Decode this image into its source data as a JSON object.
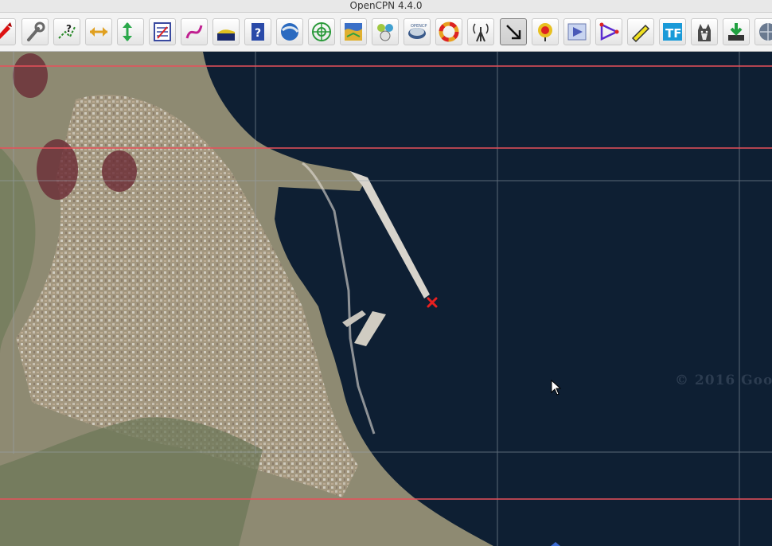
{
  "window": {
    "title": "OpenCPN 4.4.0"
  },
  "toolbar": {
    "buttons": [
      {
        "name": "routes-icon"
      },
      {
        "name": "settings-wrench-icon"
      },
      {
        "name": "route-help-icon"
      },
      {
        "name": "scale-horizontal-icon"
      },
      {
        "name": "scale-vertical-icon"
      },
      {
        "name": "route-manager-icon"
      },
      {
        "name": "track-icon"
      },
      {
        "name": "tide-icon"
      },
      {
        "name": "help-book-icon"
      },
      {
        "name": "google-earth-icon"
      },
      {
        "name": "radar-target-icon"
      },
      {
        "name": "weather-grib-icon"
      },
      {
        "name": "dashboard-icon"
      },
      {
        "name": "chart-download-icon"
      },
      {
        "name": "mob-lifebuoy-icon"
      },
      {
        "name": "ais-antenna-icon"
      },
      {
        "name": "arrow-down-right-icon"
      },
      {
        "name": "mark-add-icon"
      },
      {
        "name": "route-play-icon"
      },
      {
        "name": "waypoint-triangle-icon"
      },
      {
        "name": "ruler-icon"
      },
      {
        "name": "text-tf-icon"
      },
      {
        "name": "husky-dog-icon"
      },
      {
        "name": "save-download-icon"
      },
      {
        "name": "globe-icon"
      }
    ]
  },
  "chart": {
    "watermark": "© 2016 Goo",
    "marker": "mob-cross"
  },
  "colors": {
    "sea": "#0e1f33",
    "grid": "#9aa5b0",
    "chart_lines": "#e8505a",
    "marker": "#e82020"
  }
}
